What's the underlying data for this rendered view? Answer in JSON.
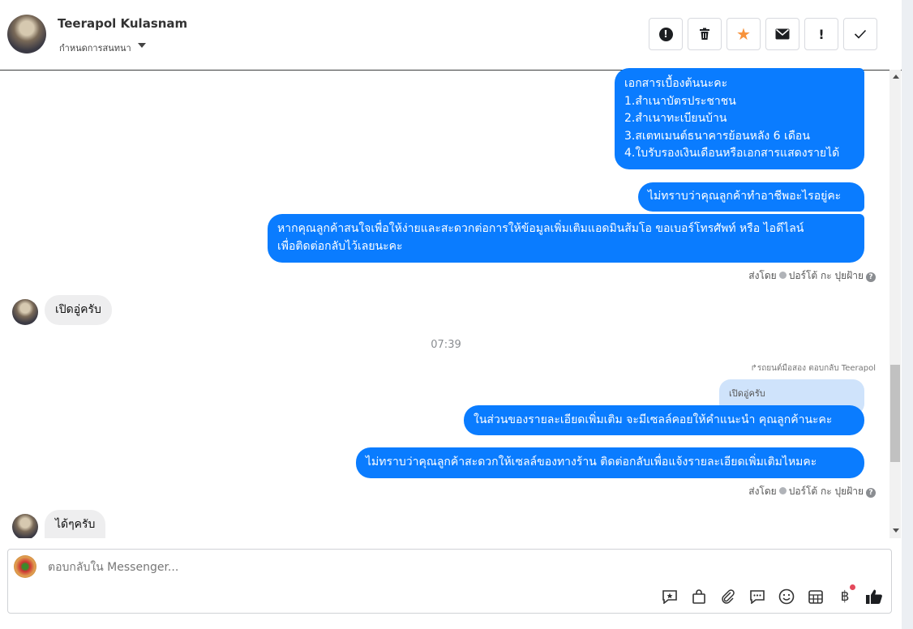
{
  "header": {
    "contact_name": "Teerapol Kulasnam",
    "assign_label": "กำหนดการสนทนา",
    "toolbar": [
      {
        "name": "alert-icon",
        "glyph": "⬤"
      },
      {
        "name": "trash-icon",
        "glyph": "🗑"
      },
      {
        "name": "star-icon",
        "glyph": "★"
      },
      {
        "name": "mail-icon",
        "glyph": "✉"
      },
      {
        "name": "exclamation-icon",
        "glyph": "!"
      },
      {
        "name": "check-icon",
        "glyph": "✓"
      }
    ]
  },
  "messages": {
    "m1_lines": [
      "เอกสารเบื้องต้นนะคะ",
      "1.สำเนาบัตรประชาชน",
      "2.สำเนาทะเบียนบ้าน",
      "3.สเตทเมนต์ธนาคารย้อนหลัง 6 เดือน",
      "4.ใบรับรองเงินเดือนหรือเอกสารแสดงรายได้"
    ],
    "m2": "ไม่ทราบว่าคุณลูกค้าทำอาชีพอะไรอยู่คะ",
    "m3_line1": "หากคุณลูกค้าสนใจเพื่อให้ง่ายและสะดวกต่อการให้ข้อมูลเพิ่มเติมแอดมินส้มโอ ขอเบอร์โทรศัพท์ หรือ ไอดีไลน์",
    "m3_line2": "เพื่อติดต่อกลับไว้เลยนะคะ",
    "sent_by_1": "ส่งโดย",
    "sent_by_name_1": "ปอร์โต้ กะ ปุยฝ้าย",
    "in1": "เปิดอู่ครับ",
    "time": "07:39",
    "reply_meta": "↱รถยนต์มือสอง ตอบกลับ Teerapol",
    "quoted": "เปิดอู่ครับ",
    "m4": "ในส่วนของรายละเอียดเพิ่มเติม จะมีเซลล์คอยให้คำแนะนำ คุณลูกค้านะคะ",
    "m5": "ไม่ทราบว่าคุณลูกค้าสะดวกให้เซลล์ของทางร้าน ติดต่อกลับเพื่อแจ้งรายละเอียดเพิ่มเติมไหมคะ",
    "sent_by_2": "ส่งโดย",
    "sent_by_name_2": "ปอร์โต้ กะ ปุยฝ้าย",
    "in2": "ได้ๆครับ"
  },
  "composer": {
    "placeholder": "ตอบกลับใน Messenger...",
    "icons": [
      {
        "name": "saved-reply-icon",
        "glyph": "💬"
      },
      {
        "name": "shop-bag-icon",
        "glyph": "👜"
      },
      {
        "name": "attachment-icon",
        "glyph": "📎"
      },
      {
        "name": "chat-icon",
        "glyph": "🗨"
      },
      {
        "name": "emoji-icon",
        "glyph": "☺"
      },
      {
        "name": "calendar-icon",
        "glyph": "▦"
      },
      {
        "name": "baht-icon",
        "glyph": "฿"
      },
      {
        "name": "like-icon",
        "glyph": "👍"
      }
    ]
  },
  "colors": {
    "outgoing": "#0a7cff",
    "incoming": "#eeeeef",
    "star": "#f7923b"
  }
}
